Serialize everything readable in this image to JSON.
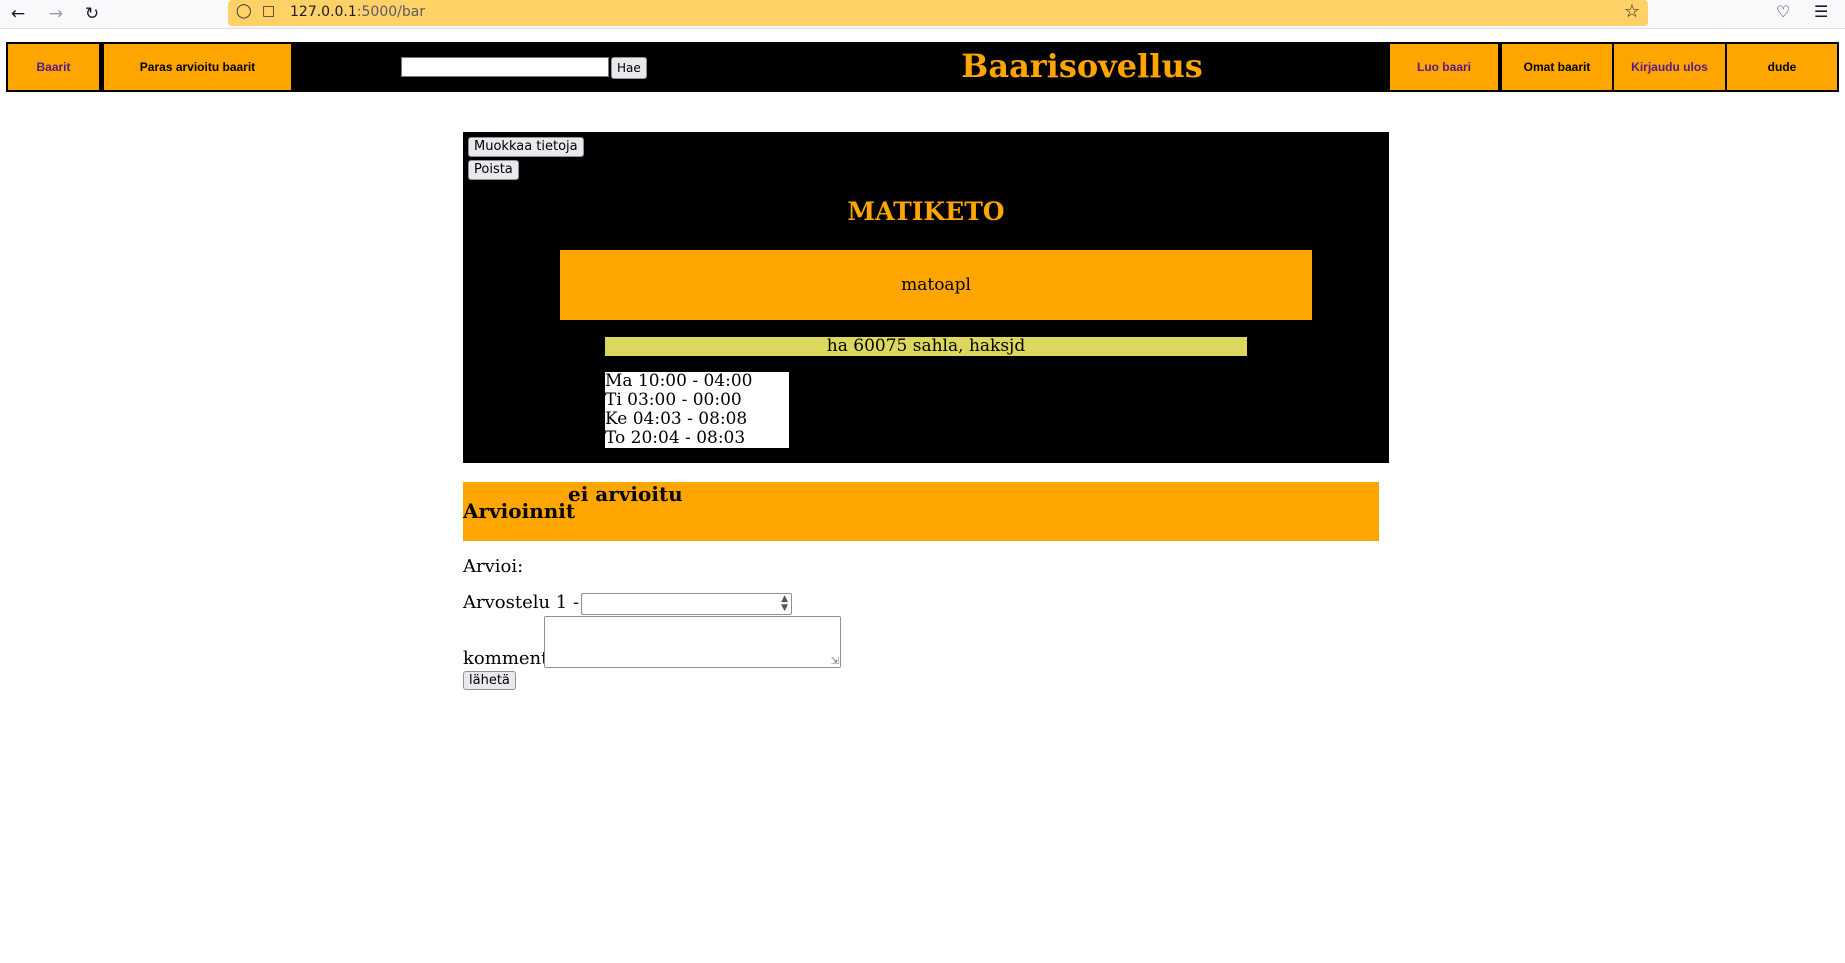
{
  "browser": {
    "url_host": "127.0.0.1",
    "url_rest": ":5000/bar",
    "icons": {
      "back": "back-arrow-icon",
      "forward": "forward-arrow-icon",
      "reload": "reload-icon",
      "shield": "shield-icon",
      "page": "page-icon",
      "bookmark": "star-icon",
      "pocket": "pocket-icon",
      "menu": "hamburger-menu-icon"
    }
  },
  "nav": {
    "bars": "Baarit",
    "best_rated": "Paras arvioitu baarit",
    "search_button": "Hae",
    "search_value": "",
    "site_title": "Baarisovellus",
    "create_bar": "Luo baari",
    "my_bars": "Omat baarit",
    "logout": "Kirjaudu ulos",
    "username": "dude"
  },
  "bar": {
    "edit_button": "Muokkaa tietoja",
    "delete_button": "Poista",
    "name": "MATIKETO",
    "description": "matoapl",
    "address": "ha 60075 sahla, haksjd",
    "hours": [
      "Ma 10:00 - 04:00",
      "Ti 03:00 - 00:00",
      "Ke 04:03 - 08:08",
      "To 20:04 - 08:03"
    ]
  },
  "reviews": {
    "heading": "Arvioinnit",
    "status": "ei arvioitu",
    "form_heading": "Arvioi:",
    "rating_label": "Arvostelu 1 - 5",
    "rating_value": "",
    "comment_label": "kommentti",
    "comment_value": "",
    "submit_button": "lähetä"
  },
  "colors": {
    "accent": "#ffa500",
    "address_bg": "#dbd85d",
    "nav_bg": "#000000",
    "urlbar_bg": "#ffd166"
  }
}
